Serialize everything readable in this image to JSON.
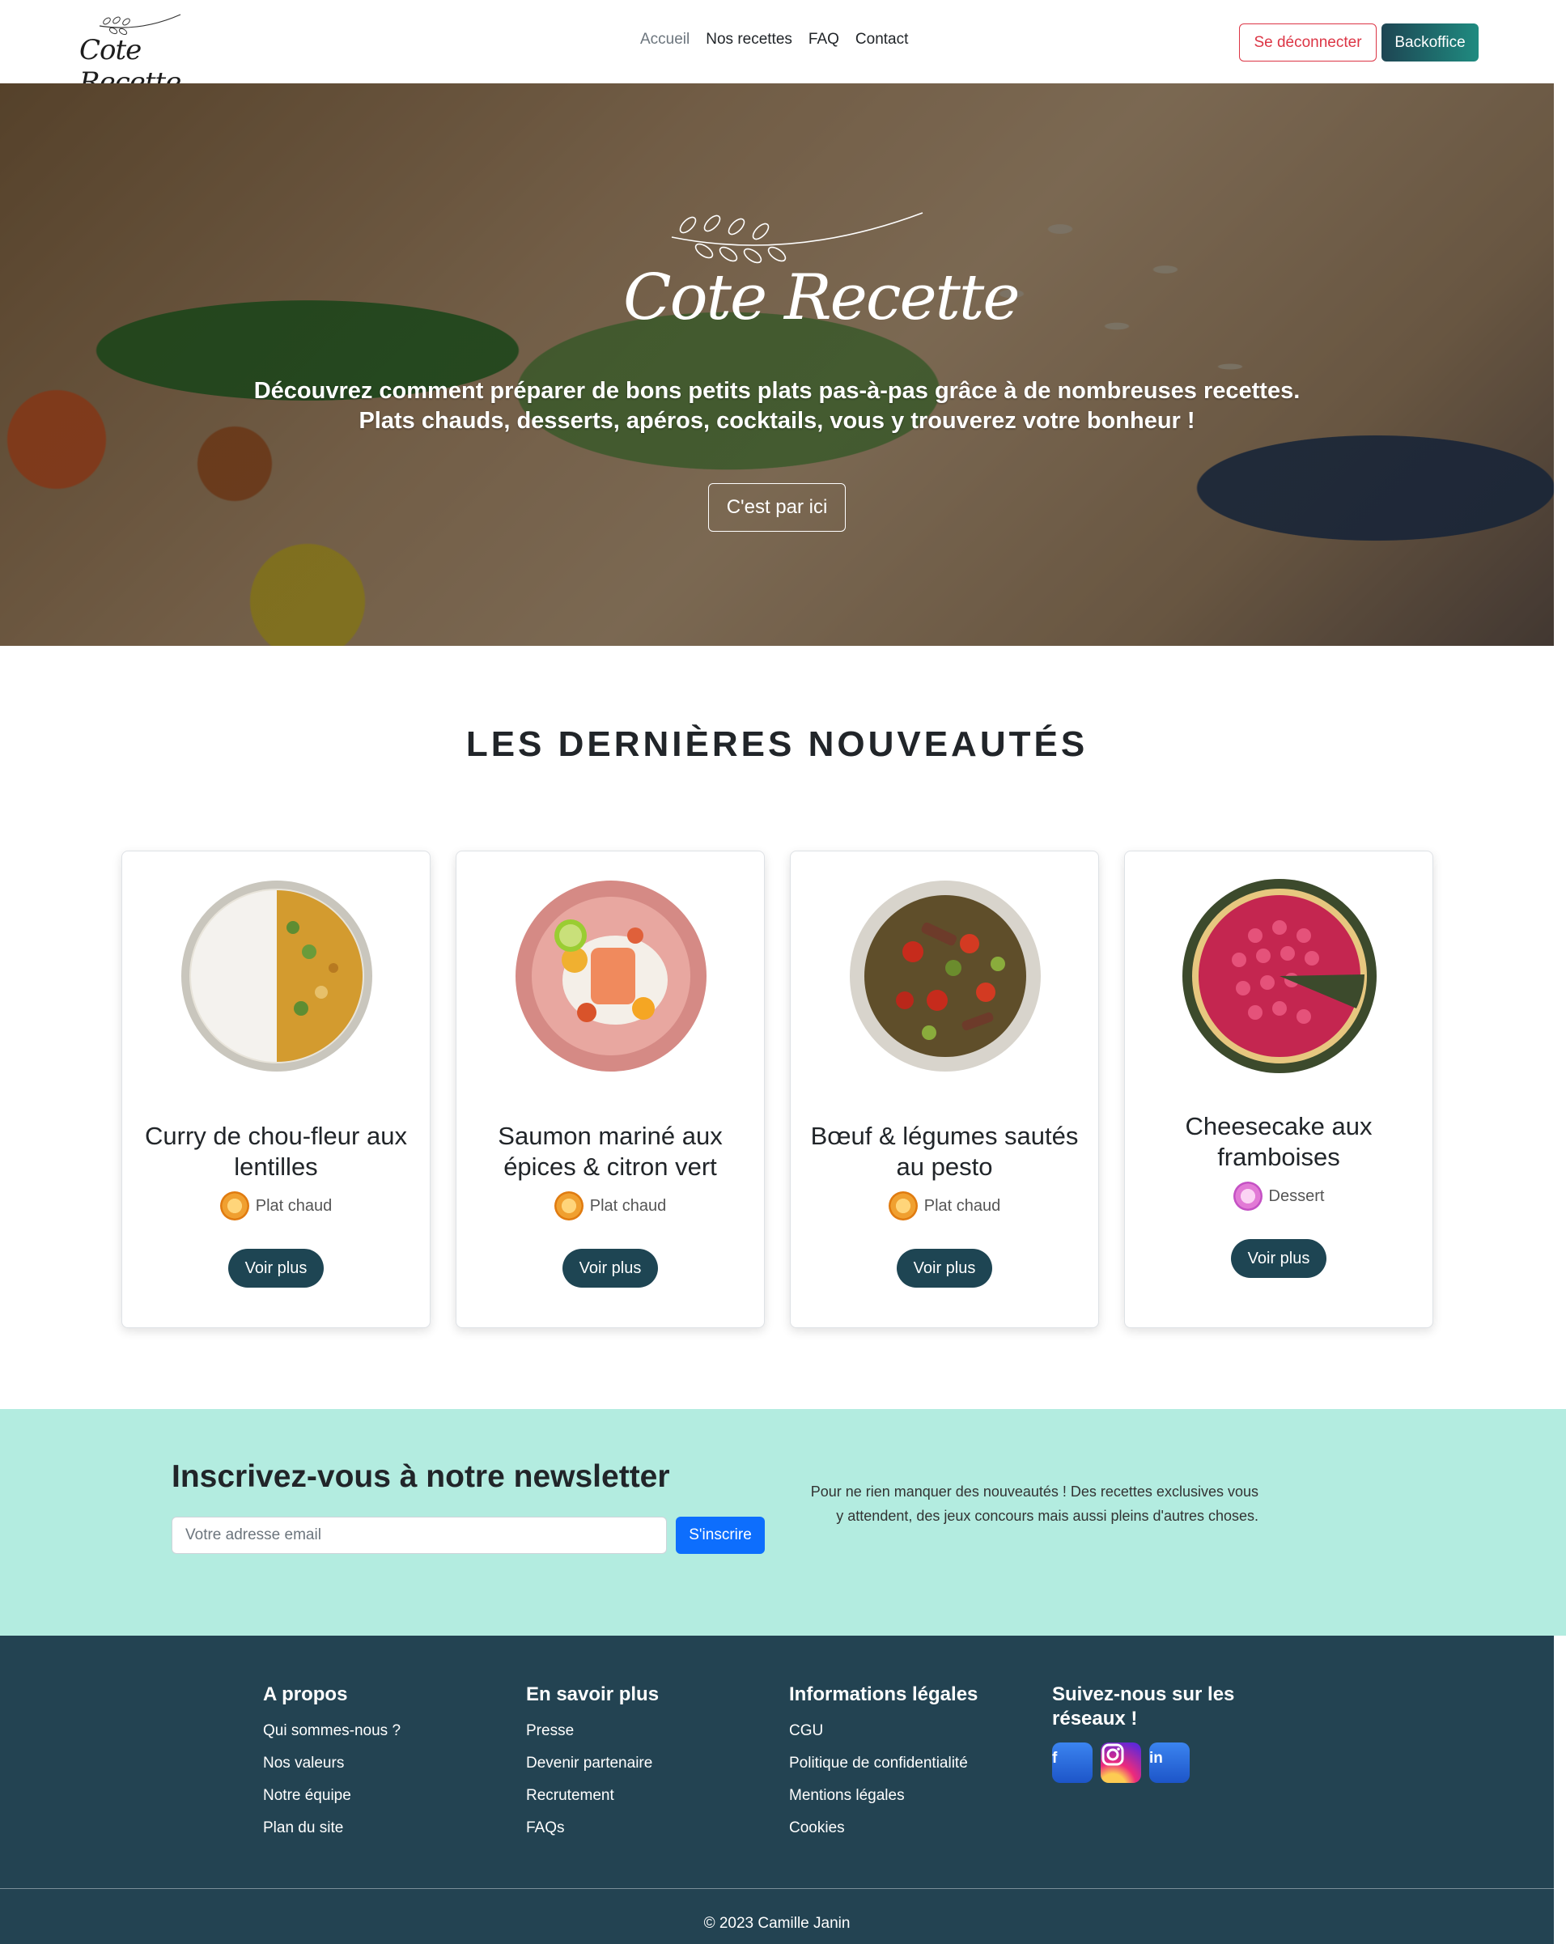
{
  "brand": {
    "name": "Cote Recette"
  },
  "nav": {
    "links": [
      {
        "label": "Accueil",
        "active": true
      },
      {
        "label": "Nos recettes",
        "active": false
      },
      {
        "label": "FAQ",
        "active": false
      },
      {
        "label": "Contact",
        "active": false
      }
    ],
    "logout_label": "Se déconnecter",
    "backoffice_label": "Backoffice"
  },
  "hero": {
    "line1": "Découvrez comment préparer de bons petits plats pas-à-pas grâce à de nombreuses recettes.",
    "line2": "Plats chauds, desserts, apéros, cocktails, vous y trouverez votre bonheur !",
    "cta_label": "C'est par ici"
  },
  "latest": {
    "title": "LES DERNIÈRES NOUVEAUTÉS",
    "cards": [
      {
        "title": "Curry de chou-fleur aux lentilles",
        "category": "Plat chaud",
        "button": "Voir plus",
        "dish": "curry"
      },
      {
        "title": "Saumon mariné aux épices & citron vert",
        "category": "Plat chaud",
        "button": "Voir plus",
        "dish": "salmon"
      },
      {
        "title": "Bœuf & légumes sautés au pesto",
        "category": "Plat chaud",
        "button": "Voir plus",
        "dish": "beef"
      },
      {
        "title": "Cheesecake aux framboises",
        "category": "Dessert",
        "button": "Voir plus",
        "dish": "cheesecake"
      }
    ]
  },
  "newsletter": {
    "title": "Inscrivez-vous à notre newsletter",
    "placeholder": "Votre adresse email",
    "button": "S'inscrire",
    "description": "Pour ne rien manquer des nouveautés ! Des recettes exclusives vous y attendent, des jeux concours mais aussi pleins d'autres choses."
  },
  "footer": {
    "columns": [
      {
        "title": "A propos",
        "links": [
          "Qui sommes-nous ?",
          "Nos valeurs",
          "Notre équipe",
          "Plan du site"
        ]
      },
      {
        "title": "En savoir plus",
        "links": [
          "Presse",
          "Devenir partenaire",
          "Recrutement",
          "FAQs"
        ]
      },
      {
        "title": "Informations légales",
        "links": [
          "CGU",
          "Politique de confidentialité",
          "Mentions légales",
          "Cookies"
        ]
      }
    ],
    "social_title": "Suivez-nous sur les réseaux !",
    "socials": [
      "facebook-icon",
      "instagram-icon",
      "linkedin-icon"
    ],
    "copyright": "© 2023 Camille Janin"
  },
  "colors": {
    "primary_dark": "#1e4553",
    "newsletter_bg": "#b3ece0",
    "footer_bg": "#234352",
    "danger": "#dc3545",
    "subscribe": "#0d6efd"
  }
}
